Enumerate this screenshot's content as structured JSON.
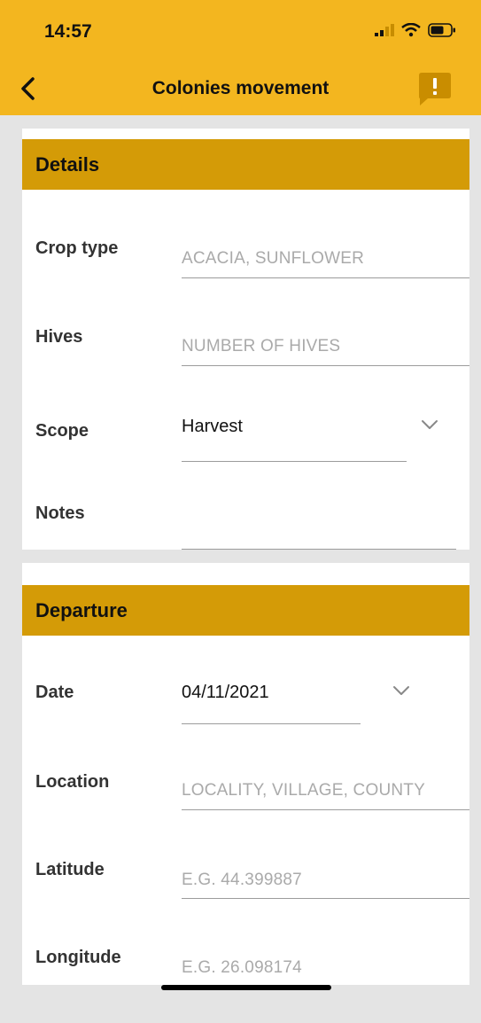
{
  "status_bar": {
    "time": "14:57"
  },
  "header": {
    "title": "Colonies movement",
    "back_icon": "chevron-left-icon",
    "report_icon": "alert-message-icon",
    "color": "#f3b61f"
  },
  "details": {
    "title": "Details",
    "crop_type": {
      "label": "Crop type",
      "placeholder": "ACACIA, SUNFLOWER"
    },
    "hives": {
      "label": "Hives",
      "placeholder": "NUMBER OF HIVES"
    },
    "scope": {
      "label": "Scope",
      "value": "Harvest"
    },
    "notes": {
      "label": "Notes",
      "value": ""
    }
  },
  "departure": {
    "title": "Departure",
    "date": {
      "label": "Date",
      "value": "04/11/2021"
    },
    "location": {
      "label": "Location",
      "placeholder": "LOCALITY, VILLAGE, COUNTY"
    },
    "latitude": {
      "label": "Latitude",
      "placeholder": "E.G. 44.399887"
    },
    "longitude": {
      "label": "Longitude",
      "placeholder": "E.G. 26.098174"
    }
  },
  "colors": {
    "section_bar": "#d49b07",
    "background": "#e4e4e4"
  }
}
